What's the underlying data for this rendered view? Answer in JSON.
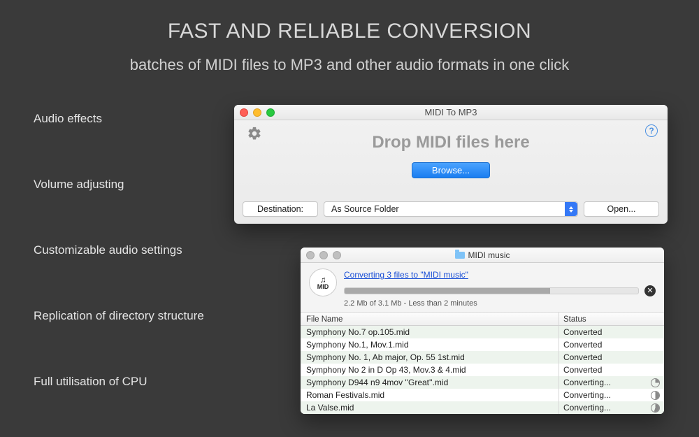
{
  "headline": "FAST AND RELIABLE CONVERSION",
  "subhead": "batches of MIDI files to MP3 and other audio formats in one click",
  "features": [
    "Audio effects",
    "Volume adjusting",
    "Customizable audio settings",
    "Replication of directory structure",
    "Full utilisation of CPU"
  ],
  "main_window": {
    "title": "MIDI To MP3",
    "drop_label": "Drop MIDI files here",
    "browse": "Browse...",
    "destination_label": "Destination:",
    "destination_value": "As Source Folder",
    "open": "Open...",
    "help_glyph": "?"
  },
  "progress_window": {
    "title": "MIDI music",
    "badge_text": "MID",
    "link_text": "Converting 3 files to \"MIDI music\"",
    "progress_pct": 70,
    "status_text": "2.2 Mb of 3.1 Mb - Less than 2 minutes",
    "col_name": "File Name",
    "col_status": "Status",
    "rows": [
      {
        "name": "Symphony No.7 op.105.mid",
        "status": "Converted",
        "pie": ""
      },
      {
        "name": "Symphony No.1, Mov.1.mid",
        "status": "Converted",
        "pie": ""
      },
      {
        "name": "Symphony No. 1, Ab major, Op. 55 1st.mid",
        "status": "Converted",
        "pie": ""
      },
      {
        "name": "Symphony No 2 in D Op 43, Mov.3 & 4.mid",
        "status": "Converted",
        "pie": ""
      },
      {
        "name": "Symphony D944 n9 4mov ''Great''.mid",
        "status": "Converting...",
        "pie": "pie-25"
      },
      {
        "name": "Roman Festivals.mid",
        "status": "Converting...",
        "pie": "pie-50"
      },
      {
        "name": "La Valse.mid",
        "status": "Converting...",
        "pie": "pie-75"
      }
    ]
  }
}
